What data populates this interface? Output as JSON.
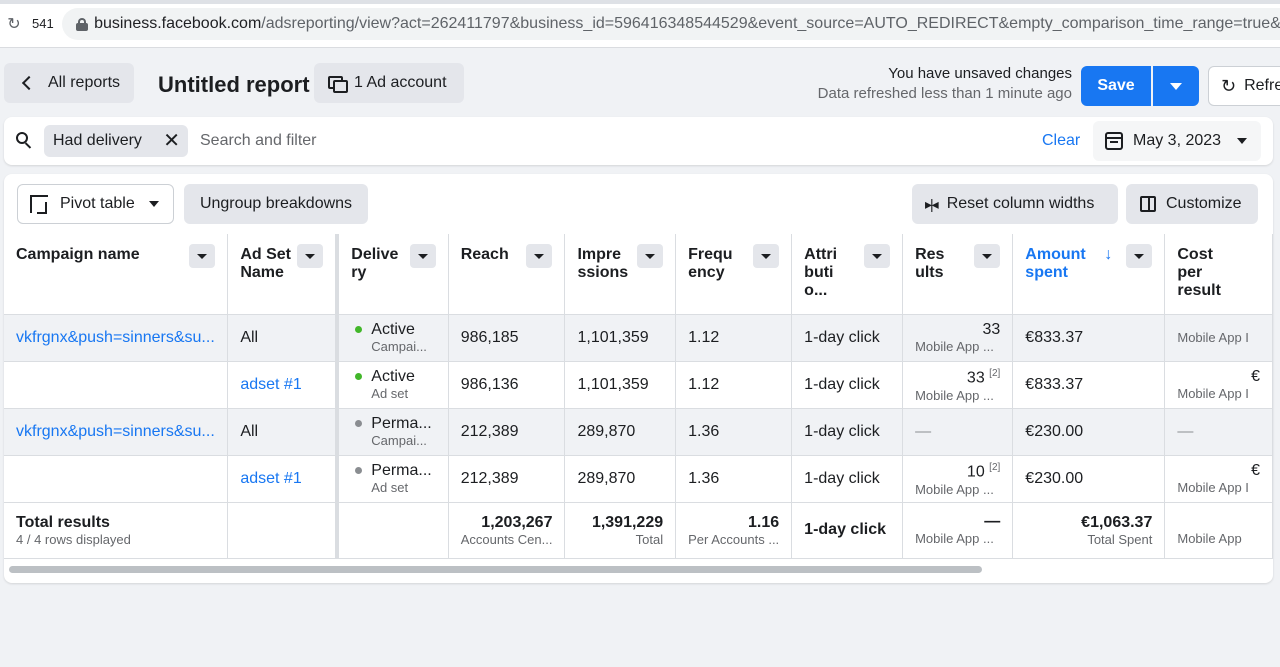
{
  "browser": {
    "tab_count": "541",
    "url_host": "business.facebook.com",
    "url_rest": "/adsreporting/view?act=262411797&business_id=596416348544529&event_source=AUTO_REDIRECT&empty_comparison_time_range=true&time_"
  },
  "header": {
    "back_label": "All reports",
    "title": "Untitled report",
    "ad_account_label": "1 Ad account",
    "unsaved_text": "You have unsaved changes",
    "refreshed_text": "Data refreshed less than 1 minute ago",
    "save_label": "Save",
    "refresh_label": "Refresh"
  },
  "filter": {
    "chip_label": "Had delivery",
    "placeholder": "Search and filter",
    "clear_label": "Clear",
    "date_label": "May 3, 2023"
  },
  "toolbar": {
    "pivot_label": "Pivot table",
    "ungroup_label": "Ungroup breakdowns",
    "reset_label": "Reset column widths",
    "customize_label": "Customize"
  },
  "columns": [
    "Campaign name",
    "Ad Set Name",
    "Delivery",
    "Reach",
    "Impressions",
    "Frequency",
    "Attribution...",
    "Results",
    "Amount spent",
    "Cost per result"
  ],
  "column_display": {
    "delivery": "Delive ry",
    "impressions": "Impre ssions",
    "frequency": "Frequ ency",
    "attribution": "Attri buti o...",
    "results": "Res ults",
    "sort_arrow": "↓"
  },
  "rows": [
    {
      "campaign": "vkfrgnx&push=sinners&su...",
      "adset": "All",
      "delivery_status": "Active",
      "delivery_sub": "Campai...",
      "reach": "986,185",
      "impressions": "1,101,359",
      "frequency": "1.12",
      "attribution": "1-day click",
      "results": "33",
      "results_sup": "",
      "results_sub": "Mobile App ...",
      "amount": "€833.37",
      "cost": "",
      "cost_sub": "Mobile App I"
    },
    {
      "campaign": "",
      "adset": "adset #1",
      "delivery_status": "Active",
      "delivery_sub": "Ad set",
      "reach": "986,136",
      "impressions": "1,101,359",
      "frequency": "1.12",
      "attribution": "1-day click",
      "results": "33",
      "results_sup": "[2]",
      "results_sub": "Mobile App ...",
      "amount": "€833.37",
      "cost": "€",
      "cost_sub": "Mobile App I"
    },
    {
      "campaign": "vkfrgnx&push=sinners&su...",
      "adset": "All",
      "delivery_status": "Perma...",
      "delivery_sub": "Campai...",
      "reach": "212,389",
      "impressions": "289,870",
      "frequency": "1.36",
      "attribution": "1-day click",
      "results": "—",
      "results_sup": "",
      "results_sub": "",
      "amount": "€230.00",
      "cost": "—",
      "cost_sub": ""
    },
    {
      "campaign": "",
      "adset": "adset #1",
      "delivery_status": "Perma...",
      "delivery_sub": "Ad set",
      "reach": "212,389",
      "impressions": "289,870",
      "frequency": "1.36",
      "attribution": "1-day click",
      "results": "10",
      "results_sup": "[2]",
      "results_sub": "Mobile App ...",
      "amount": "€230.00",
      "cost": "€",
      "cost_sub": "Mobile App I"
    }
  ],
  "totals": {
    "label": "Total results",
    "rows_displayed": "4 / 4 rows displayed",
    "reach": "1,203,267",
    "reach_sub": "Accounts Cen...",
    "impressions": "1,391,229",
    "impressions_sub": "Total",
    "frequency": "1.16",
    "frequency_sub": "Per Accounts ...",
    "attribution": "1-day click",
    "results": "—",
    "results_sub": "Mobile App ...",
    "amount": "€1,063.37",
    "amount_sub": "Total Spent",
    "cost_sub": "Mobile App"
  },
  "colors": {
    "accent": "#1877f2",
    "active_dot": "#42b72a",
    "inactive_dot": "#8a8d91"
  }
}
